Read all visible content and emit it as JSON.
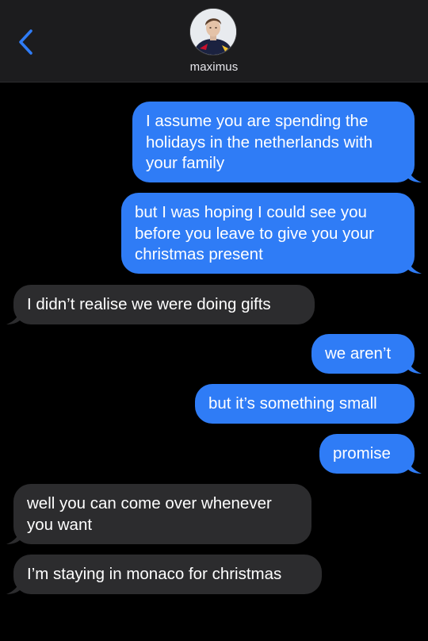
{
  "header": {
    "contact_name": "maximus"
  },
  "messages": [
    {
      "direction": "outgoing",
      "text": "I assume you are spending the\nholidays in the netherlands with\nyour family"
    },
    {
      "direction": "outgoing",
      "text": "but I was hoping I could see you\nbefore you leave to give you your\nchristmas present"
    },
    {
      "direction": "incoming",
      "text": "I didn’t realise we were doing gifts"
    },
    {
      "direction": "outgoing",
      "text": "we aren’t"
    },
    {
      "direction": "outgoing",
      "text": "but it’s something small"
    },
    {
      "direction": "outgoing",
      "text": "promise"
    },
    {
      "direction": "incoming",
      "text": "well you can come over whenever\nyou want"
    },
    {
      "direction": "incoming",
      "text": "I’m staying in monaco for christmas"
    }
  ],
  "colors": {
    "outgoing_bubble": "#2f7cf6",
    "incoming_bubble": "#2c2c2e",
    "background": "#000000",
    "header": "#1c1c1e",
    "accent": "#2f7cf6"
  },
  "icons": {
    "back": "chevron-left-icon",
    "avatar": "contact-avatar"
  }
}
